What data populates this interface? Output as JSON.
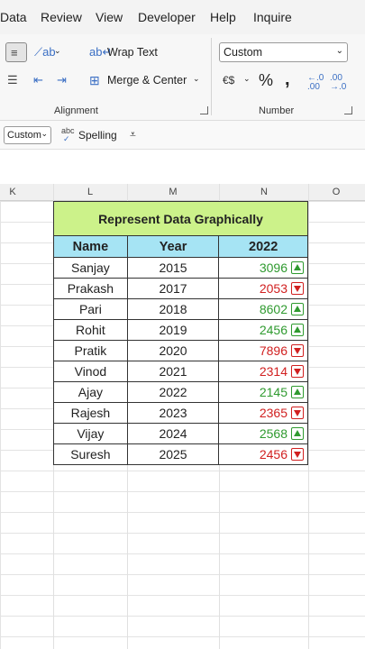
{
  "menu": [
    "Data",
    "Review",
    "View",
    "Developer",
    "Help",
    "Inquire"
  ],
  "ribbon": {
    "wrap_text": "Wrap Text",
    "merge_center": "Merge & Center",
    "alignment_label": "Alignment",
    "number_format_value": "Custom",
    "percent": "%",
    "comma": "̹",
    "increase_decimal": "←.0 .00",
    "decrease_decimal": ".00 →.0",
    "number_label": "Number"
  },
  "qat": {
    "format_combo": "Custom",
    "spelling": "Spelling",
    "abc": "abc"
  },
  "columns": [
    "K",
    "L",
    "M",
    "N",
    "O"
  ],
  "table": {
    "title": "Represent Data Graphically",
    "headers": [
      "Name",
      "Year",
      "2022"
    ],
    "rows": [
      {
        "name": "Sanjay",
        "year": "2015",
        "value": "3096",
        "trend": "up"
      },
      {
        "name": "Prakash",
        "year": "2017",
        "value": "2053",
        "trend": "down"
      },
      {
        "name": "Pari",
        "year": "2018",
        "value": "8602",
        "trend": "up"
      },
      {
        "name": "Rohit",
        "year": "2019",
        "value": "2456",
        "trend": "up"
      },
      {
        "name": "Pratik",
        "year": "2020",
        "value": "7896",
        "trend": "down"
      },
      {
        "name": "Vinod",
        "year": "2021",
        "value": "2314",
        "trend": "down"
      },
      {
        "name": "Ajay",
        "year": "2022",
        "value": "2145",
        "trend": "up"
      },
      {
        "name": "Rajesh",
        "year": "2023",
        "value": "2365",
        "trend": "down"
      },
      {
        "name": "Vijay",
        "year": "2024",
        "value": "2568",
        "trend": "up"
      },
      {
        "name": "Suresh",
        "year": "2025",
        "value": "2456",
        "trend": "down"
      }
    ]
  },
  "colors": {
    "title_bg": "#ccf28a",
    "header_bg": "#a6e4f4",
    "up": "#2f9a2f",
    "down": "#d12020"
  }
}
